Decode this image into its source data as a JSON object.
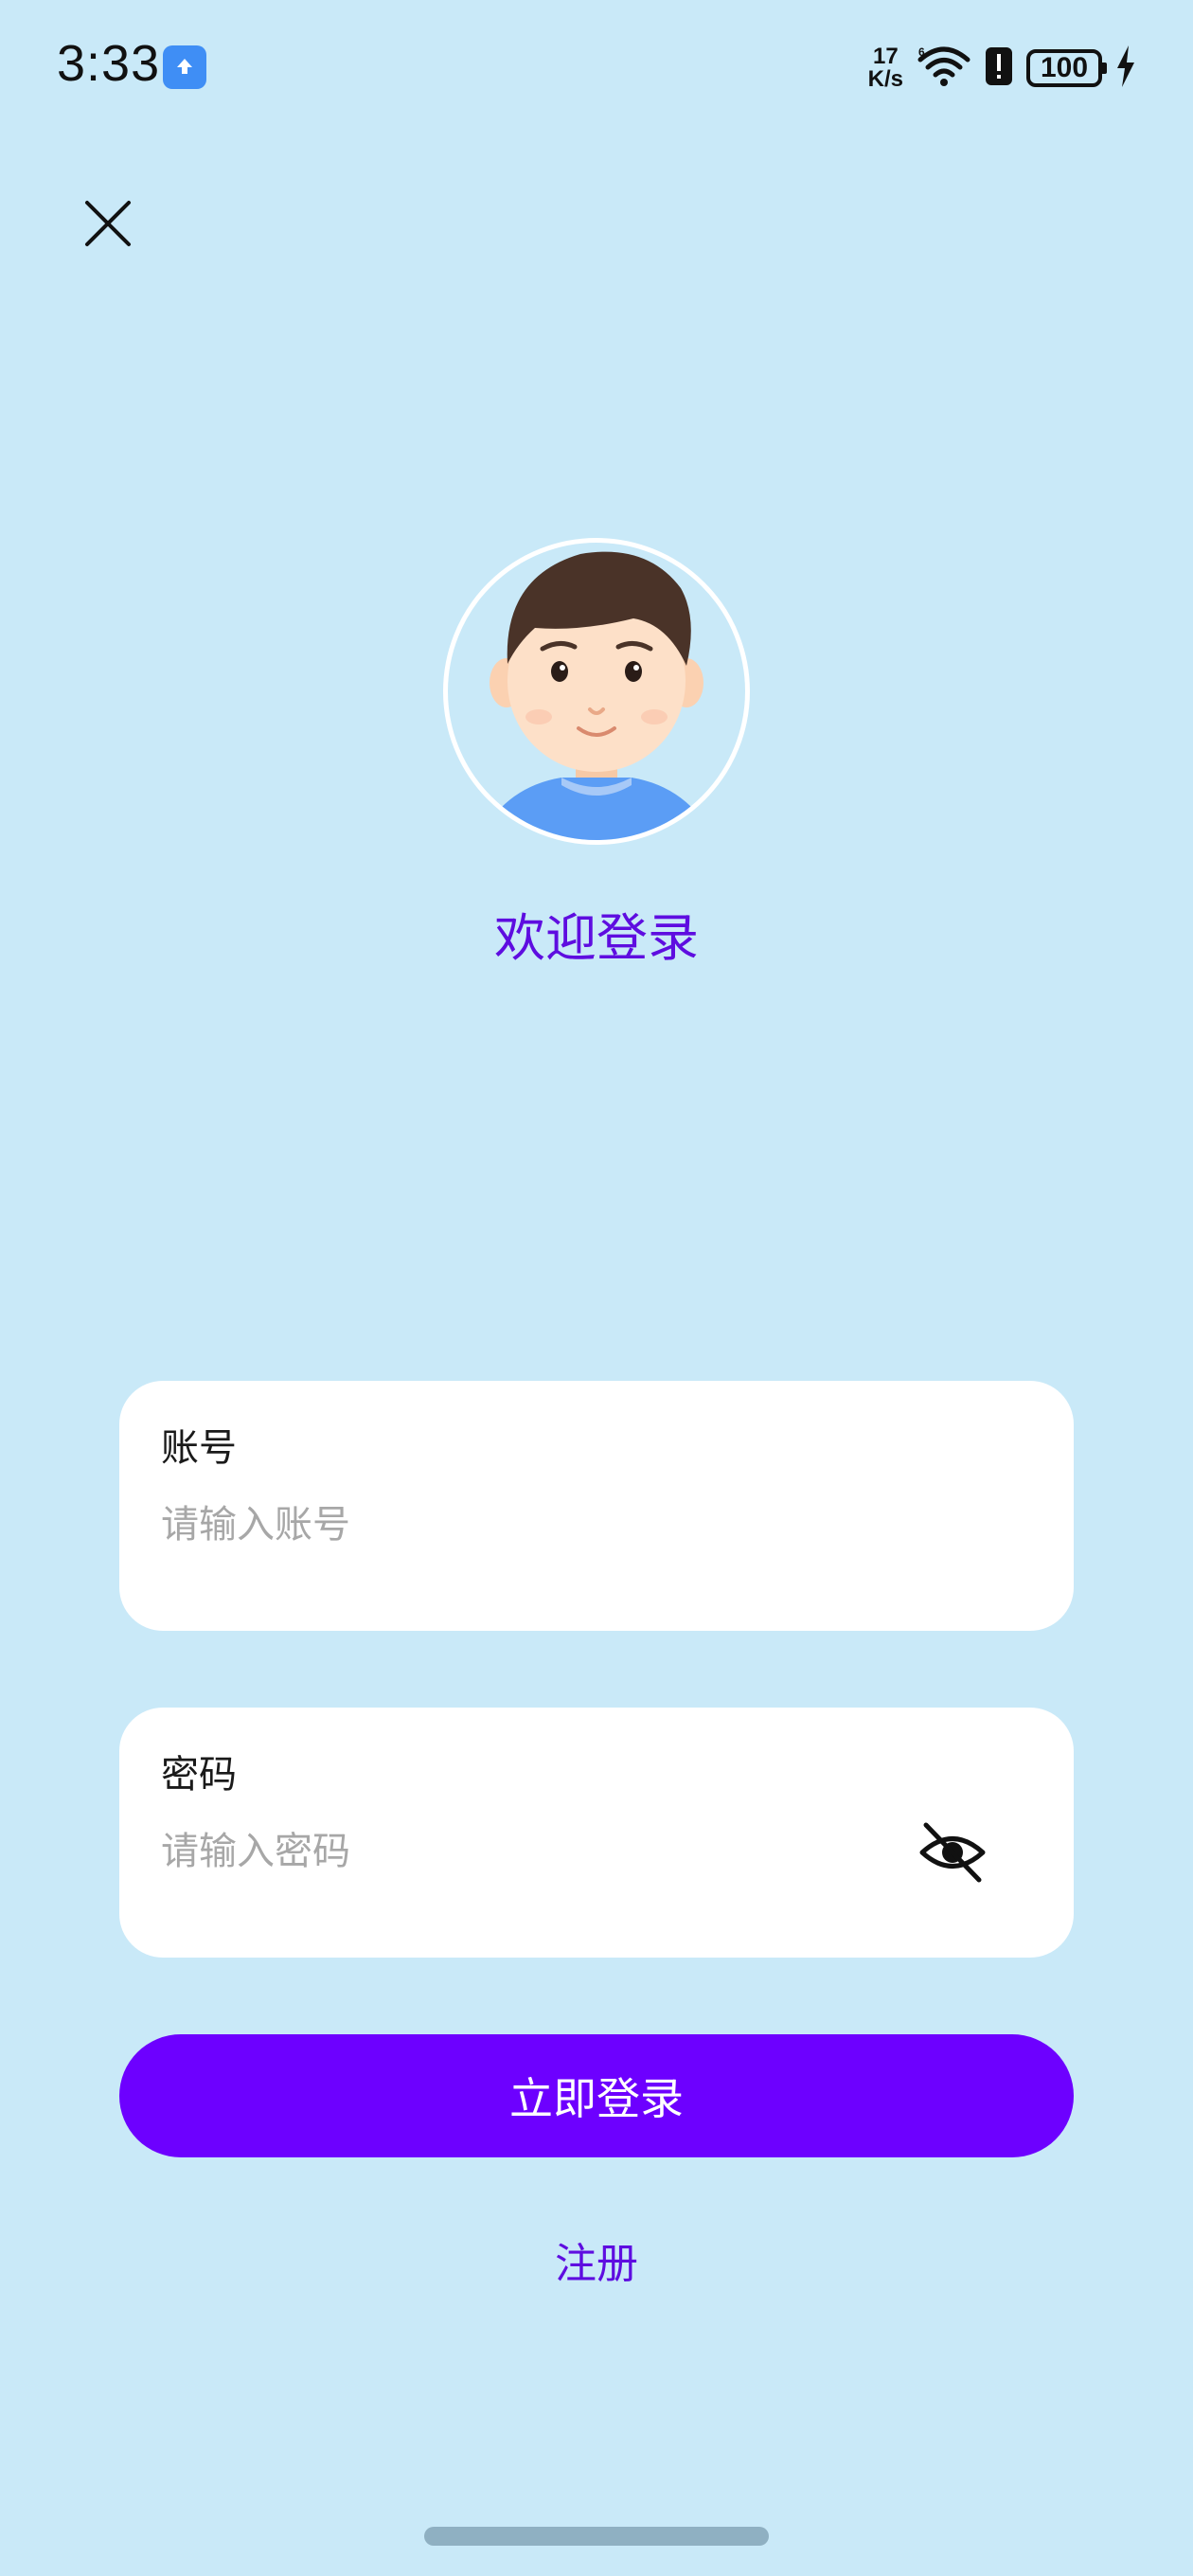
{
  "status_bar": {
    "time": "3:33",
    "net_speed_value": "17",
    "net_speed_unit": "K/s",
    "battery_level": "100",
    "app_icon": "upload-icon",
    "icons": [
      "wifi-icon",
      "alert-icon",
      "battery-icon",
      "charging-bolt-icon"
    ]
  },
  "header": {
    "close_icon": "close-icon"
  },
  "profile": {
    "title": "欢迎登录"
  },
  "form": {
    "account": {
      "label": "账号",
      "value": "",
      "placeholder": "请输入账号"
    },
    "password": {
      "label": "密码",
      "value": "",
      "placeholder": "请输入密码",
      "toggle_icon": "eye-off-icon"
    },
    "login_label": "立即登录",
    "register_label": "注册"
  },
  "colors": {
    "background": "#c9e9f8",
    "accent": "#6d00ff",
    "accent_text": "#5e0de0"
  }
}
